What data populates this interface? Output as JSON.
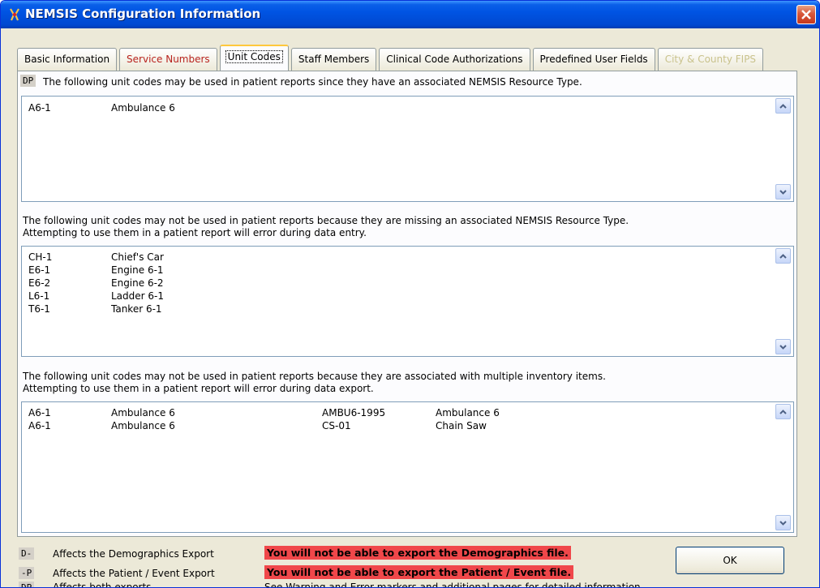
{
  "window": {
    "title": "NEMSIS Configuration Information"
  },
  "tabs": [
    {
      "label": "Basic Information"
    },
    {
      "label": "Service Numbers"
    },
    {
      "label": "Unit Codes"
    },
    {
      "label": "Staff Members"
    },
    {
      "label": "Clinical Code Authorizations"
    },
    {
      "label": "Predefined User Fields"
    },
    {
      "label": "City & County FIPS"
    }
  ],
  "section1": {
    "marker": "DP",
    "description": "The following unit codes may be used in patient reports since they have an associated NEMSIS Resource Type.",
    "rows": [
      {
        "code": "A6-1",
        "name": "Ambulance 6"
      }
    ]
  },
  "section2": {
    "line1": "The following unit codes may not be used in patient reports because they are missing an associated NEMSIS Resource Type.",
    "line2": "Attempting to use them in a patient report will error during data entry.",
    "rows": [
      {
        "code": "CH-1",
        "name": "Chief's Car"
      },
      {
        "code": "E6-1",
        "name": "Engine 6-1"
      },
      {
        "code": "E6-2",
        "name": "Engine 6-2"
      },
      {
        "code": "L6-1",
        "name": "Ladder 6-1"
      },
      {
        "code": "T6-1",
        "name": "Tanker 6-1"
      }
    ]
  },
  "section3": {
    "line1": "The following unit codes may not be used in patient reports because they are associated with multiple inventory items.",
    "line2": "Attempting to use them in a patient report will error during data export.",
    "rows": [
      {
        "code": "A6-1",
        "name": "Ambulance 6",
        "item_code": "AMBU6-1995",
        "item_name": "Ambulance 6"
      },
      {
        "code": "A6-1",
        "name": "Ambulance 6",
        "item_code": "CS-01",
        "item_name": "Chain Saw"
      }
    ]
  },
  "legend": {
    "demographics": {
      "marker": "D-",
      "label": "Affects the Demographics Export",
      "warning": "You will not be able to export the Demographics file."
    },
    "patient": {
      "marker": "-P",
      "label": "Affects the Patient / Event Export",
      "warning": "You will not be able to export the Patient / Event file."
    },
    "both": {
      "marker": "DP",
      "label": "Affects both exports",
      "info": "See Warning and Error markers and additional pages for detailed information."
    }
  },
  "buttons": {
    "ok": "OK"
  },
  "colors": {
    "titlebar": "#0054e3",
    "warning_bg": "#f0474a",
    "red_tab_text": "#b8231e",
    "disabled_tab_text": "#c9c28c"
  },
  "icons": {
    "app": "app-icon",
    "close": "close-icon",
    "scroll_up": "chevron-up-icon",
    "scroll_down": "chevron-down-icon"
  }
}
